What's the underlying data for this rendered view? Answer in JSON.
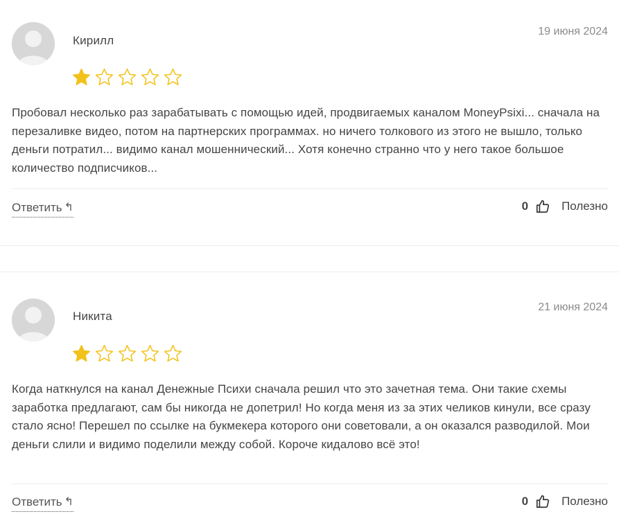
{
  "reviews": [
    {
      "author": "Кирилл",
      "date": "19 июня 2024",
      "rating": 1,
      "max_rating": 5,
      "text": "Пробовал несколько раз зарабатывать с помощью идей, продвигаемых каналом MoneyPsixi... сначала на перезаливке видео, потом на партнерских программах. но ничего толкового из этого не вышло, только деньги потратил... видимо канал мошеннический... Хотя конечно странно что у него такое большое количество подписчиков...",
      "reply_label": "Ответить",
      "helpful_count": "0",
      "helpful_label": "Полезно"
    },
    {
      "author": "Никита",
      "date": "21 июня 2024",
      "rating": 1,
      "max_rating": 5,
      "text": "Когда наткнулся на канал Денежные Психи сначала решил что это зачетная тема. Они такие схемы заработка предлагают, сам бы никогда не допетрил! Но когда меня из за этих челиков кинули, все сразу стало ясно! Перешел по ссылке на букмекера которого они советовали, а он оказался разводилой. Мои деньги слили и видимо поделили между собой. Короче кидалово всё это!",
      "reply_label": "Ответить",
      "helpful_count": "0",
      "helpful_label": "Полезно"
    }
  ],
  "colors": {
    "star_filled": "#F2C21B",
    "star_empty_stroke": "#F2C21B",
    "text": "#444444",
    "date": "#8a8a8a",
    "avatar_bg": "#d7d7d7"
  },
  "icons": {
    "avatar": "avatar-placeholder-icon",
    "star": "star-icon",
    "reply": "reply-arrow-icon",
    "helpful": "thumbs-up-icon"
  }
}
